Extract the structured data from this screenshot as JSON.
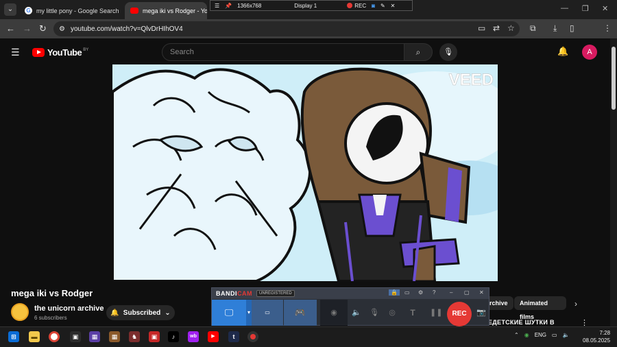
{
  "browser": {
    "tabs": [
      {
        "label": "my little pony - Google Search",
        "favicon_color": "#ffffff"
      },
      {
        "label": "mega iki vs Rodger - YouTube",
        "favicon_color": "#ff0000"
      }
    ],
    "url": "youtube.com/watch?v=QlvDrHIhOV4"
  },
  "bandicam_top": {
    "resolution": "1366x768",
    "display": "Display 1",
    "rec_label": "REC"
  },
  "youtube": {
    "logo_text": "YouTube",
    "country_code": "BY",
    "search_placeholder": "Search",
    "avatar_letter": "A"
  },
  "video": {
    "watermark": "VEED",
    "title": "mega iki vs Rodger"
  },
  "channel": {
    "name": "the unicorn archive",
    "subscribers": "6 subscribers",
    "subscribe_label": "Subscribed"
  },
  "chips": [
    "rchive",
    "Animated films"
  ],
  "recommendation_snippet": "ЕДЕТСКИЕ ШУТКИ В",
  "bandicam_panel": {
    "brand_left": "BANDI",
    "brand_right": "CAM",
    "unregistered": "UNREGISTERED",
    "rec_label": "REC"
  },
  "taskbar": {
    "language": "ENG",
    "time": "7:28",
    "date": "08.05.2025"
  }
}
